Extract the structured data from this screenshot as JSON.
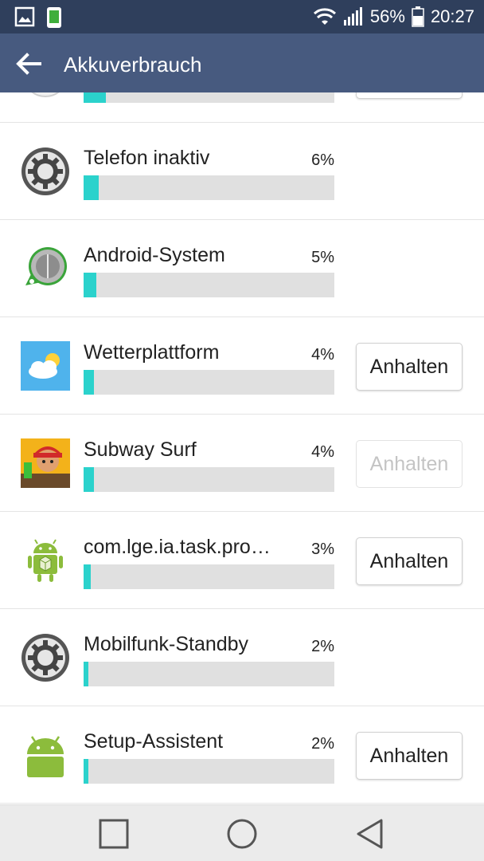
{
  "status_bar": {
    "battery_percent": "56%",
    "time": "20:27",
    "icons": [
      "gallery-icon",
      "phone-card-icon",
      "wifi-icon",
      "signal-icon",
      "battery-icon"
    ]
  },
  "action_bar": {
    "title": "Akkuverbrauch",
    "back_icon": "arrow-left-icon"
  },
  "list": {
    "partial_top_fraction": 0.09,
    "items": [
      {
        "name": "Telefon inaktiv",
        "percent": "6%",
        "fraction": 0.06,
        "icon": "gear-icon",
        "stop_button": null
      },
      {
        "name": "Android-System",
        "percent": "5%",
        "fraction": 0.05,
        "icon": "android-system-icon",
        "stop_button": null
      },
      {
        "name": "Wetterplattform",
        "percent": "4%",
        "fraction": 0.04,
        "icon": "weather-icon",
        "stop_button": {
          "label": "Anhalten",
          "enabled": true
        }
      },
      {
        "name": "Subway Surf",
        "percent": "4%",
        "fraction": 0.04,
        "icon": "subway-surf-icon",
        "stop_button": {
          "label": "Anhalten",
          "enabled": false
        }
      },
      {
        "name": "com.lge.ia.task.pro…",
        "percent": "3%",
        "fraction": 0.03,
        "icon": "android-package-icon",
        "stop_button": {
          "label": "Anhalten",
          "enabled": true
        }
      },
      {
        "name": "Mobilfunk-Standby",
        "percent": "2%",
        "fraction": 0.02,
        "icon": "gear-icon",
        "stop_button": null
      },
      {
        "name": "Setup-Assistent",
        "percent": "2%",
        "fraction": 0.02,
        "icon": "android-icon",
        "stop_button": {
          "label": "Anhalten",
          "enabled": true
        }
      }
    ]
  },
  "nav_bar": {
    "recents_icon": "square-icon",
    "home_icon": "circle-icon",
    "back_icon": "triangle-back-icon"
  },
  "colors": {
    "status_bar_bg": "#2f3f5c",
    "action_bar_bg": "#475a7f",
    "bar_fill": "#2bd2cc",
    "bar_track": "#e0e0e0"
  }
}
